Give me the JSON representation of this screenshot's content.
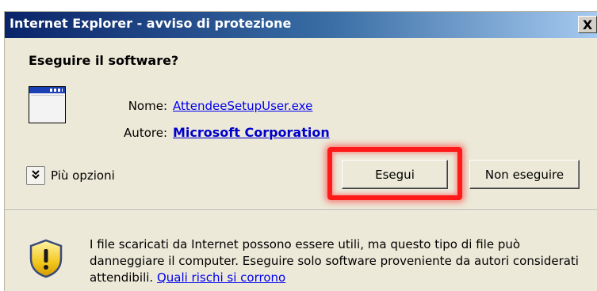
{
  "window": {
    "title": "Internet Explorer - avviso di protezione",
    "close_label": "X"
  },
  "dialog": {
    "heading": "Eseguire il software?",
    "name_label": "Nome:",
    "file_name": "AttendeeSetupUser.exe",
    "author_label": "Autore:",
    "publisher": "Microsoft Corporation",
    "more_options_label": "Più opzioni",
    "more_options_icon": "chevron-double-down-icon"
  },
  "buttons": {
    "run_label": "Esegui",
    "dont_run_label": "Non eseguire"
  },
  "warning": {
    "text": "I file scaricati da Internet possono essere utili, ma questo tipo di file può danneggiare il computer. Eseguire solo software proveniente da autori considerati attendibili.",
    "link_label": "Quali rischi si corrono"
  },
  "colors": {
    "titlebar_start": "#0a246a",
    "titlebar_end": "#a6caf0",
    "highlight": "#ff1a1a",
    "link": "#0000ee",
    "dialog_bg": "#ece9d8"
  }
}
